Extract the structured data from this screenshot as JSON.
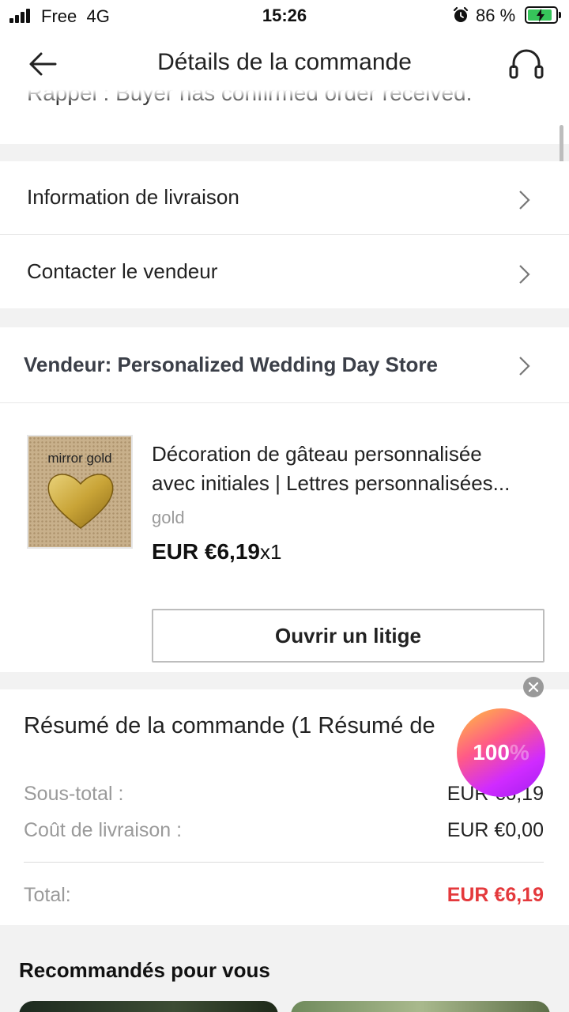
{
  "status_bar": {
    "carrier": "Free",
    "network": "4G",
    "time": "15:26",
    "battery_percent": "86 %"
  },
  "header": {
    "title": "Détails de la commande",
    "partially_hidden_text": "Rappel : Buyer has confirmed order received."
  },
  "delivery_info": {
    "label": "Information de livraison"
  },
  "contact_seller": {
    "label": "Contacter le vendeur"
  },
  "vendor": {
    "label": "Vendeur: Personalized Wedding Day Store"
  },
  "product": {
    "image_label": "mirror gold",
    "title_line1": "Décoration de gâteau personnalisée",
    "title_line2": "avec initiales | Lettres personnalisées...",
    "variant": "gold",
    "price": "EUR €6,19",
    "quantity": "x1",
    "dispute_button": "Ouvrir un litige"
  },
  "summary": {
    "title": "Résumé de la commande (1 Résumé de",
    "subtotal_label": "Sous-total :",
    "subtotal_value": "EUR €6,19",
    "shipping_label": "Coût de livraison :",
    "shipping_value": "EUR €0,00",
    "total_label": "Total:",
    "total_value": "EUR €6,19"
  },
  "promo": {
    "label": "100",
    "suffix": "%"
  },
  "recommended": {
    "title": "Recommandés pour vous"
  },
  "colors": {
    "accent_red": "#e4393c",
    "background_gray": "#f2f2f2",
    "battery_green": "#36c45a"
  }
}
